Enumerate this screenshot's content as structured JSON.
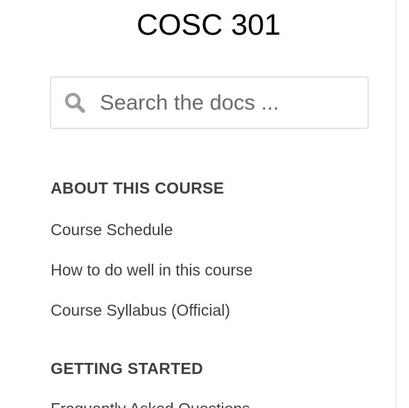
{
  "site": {
    "title": "COSC 301"
  },
  "search": {
    "placeholder": "Search the docs ...",
    "icon": "search-icon"
  },
  "nav": {
    "sections": [
      {
        "heading": "ABOUT THIS COURSE",
        "items": [
          {
            "label": "Course Schedule"
          },
          {
            "label": "How to do well in this course"
          },
          {
            "label": "Course Syllabus (Official)"
          }
        ]
      },
      {
        "heading": "GETTING STARTED",
        "items": [
          {
            "label": "Frequently Asked Questions"
          }
        ]
      }
    ]
  },
  "colors": {
    "text": "#404040",
    "title": "#000000",
    "border": "#e3e3e3",
    "icon": "#9e9e9e"
  }
}
